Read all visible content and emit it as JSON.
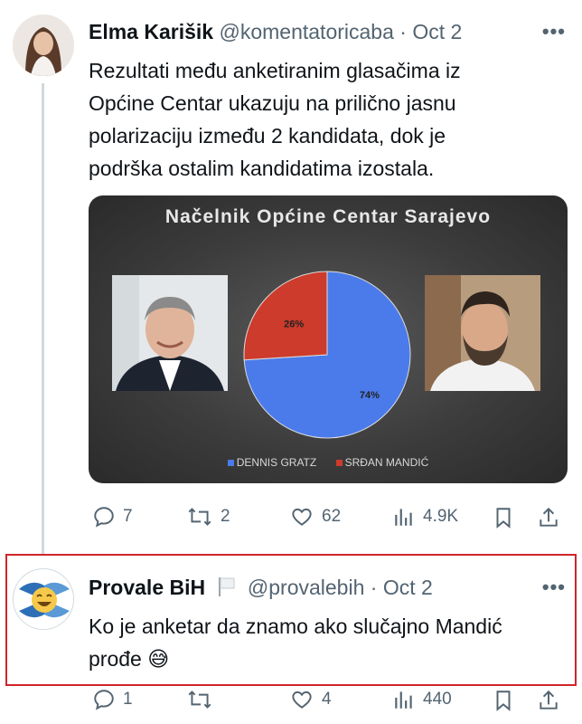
{
  "tweet1": {
    "name": "Elma Karišik",
    "handle": "@komentatoricaba",
    "date": "· Oct 2",
    "text": "Rezultati među anketiranim glasačima iz\nOpćine Centar ukazuju na prilično jasnu\npolarizaciju između 2 kandidata, dok je\npodrška ostalim kandidatima izostala.",
    "replies": "7",
    "reposts": "2",
    "likes": "62",
    "views": "4.9K"
  },
  "chart_data": {
    "type": "pie",
    "title": "Načelnik Općine Centar Sarajevo",
    "categories": [
      "DENNIS GRATZ",
      "SRĐAN MANDIĆ"
    ],
    "values": [
      74,
      26
    ],
    "labels": [
      "74%",
      "26%"
    ],
    "colors": [
      "#4b7bea",
      "#cc3b2b"
    ],
    "legend_position": "bottom"
  },
  "tweet2": {
    "name": "Provale BiH",
    "handle": "@provalebih",
    "date": "· Oct 2",
    "text": "Ko je anketar da znamo ako slučajno Mandić\nprođe 😅",
    "replies": "1",
    "reposts": "",
    "likes": "4",
    "views": "440"
  },
  "icons": {
    "reply": "reply-icon",
    "repost": "repost-icon",
    "like": "heart-icon",
    "views": "views-icon",
    "bookmark": "bookmark-icon",
    "share": "share-icon",
    "more": "more-icon",
    "flag": "flag-icon"
  },
  "colors": {
    "highlight_border": "#d0252b",
    "muted": "#536471"
  }
}
